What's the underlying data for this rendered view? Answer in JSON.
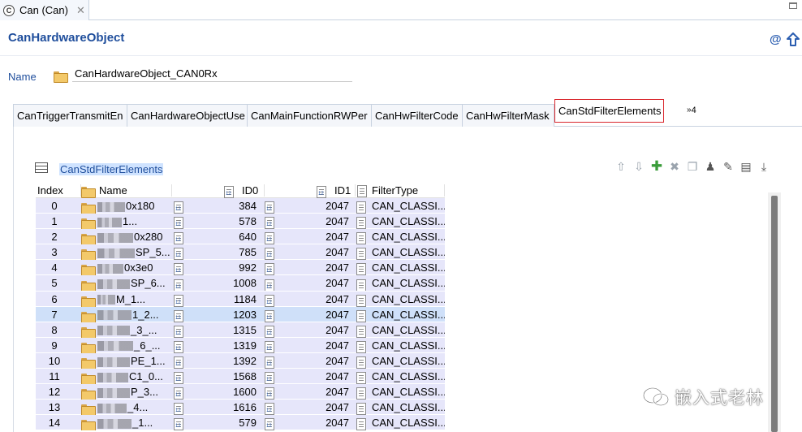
{
  "editor_tab": {
    "title": "Can (Can)",
    "close": "✕"
  },
  "header": {
    "title": "CanHardwareObject"
  },
  "name_field": {
    "label": "Name",
    "value": "CanHardwareObject_CAN0Rx"
  },
  "tabs": [
    {
      "label": "CanTriggerTransmitEn",
      "active": false
    },
    {
      "label": "CanHardwareObjectUse",
      "active": false
    },
    {
      "label": "CanMainFunctionRWPer",
      "active": false
    },
    {
      "label": "CanHwFilterCode",
      "active": false
    },
    {
      "label": "CanHwFilterMask",
      "active": false
    },
    {
      "label": "CanStdFilterElements",
      "active": true
    }
  ],
  "tabs_more": {
    "chevron": "»",
    "count": "4"
  },
  "section": {
    "title": "CanStdFilterElements"
  },
  "table": {
    "columns": {
      "index": "Index",
      "name": "Name",
      "id0": "ID0",
      "id1": "ID1",
      "filtertype": "FilterType"
    },
    "rows": [
      {
        "index": "0",
        "name": "0x180",
        "id0": "384",
        "id1": "2047",
        "filtertype": "CAN_CLASSI...",
        "selected": false
      },
      {
        "index": "1",
        "name": "1...",
        "id0": "578",
        "id1": "2047",
        "filtertype": "CAN_CLASSI...",
        "selected": false
      },
      {
        "index": "2",
        "name": "0x280",
        "id0": "640",
        "id1": "2047",
        "filtertype": "CAN_CLASSI...",
        "selected": false
      },
      {
        "index": "3",
        "name": "SP_5...",
        "id0": "785",
        "id1": "2047",
        "filtertype": "CAN_CLASSI...",
        "selected": false
      },
      {
        "index": "4",
        "name": "0x3e0",
        "id0": "992",
        "id1": "2047",
        "filtertype": "CAN_CLASSI...",
        "selected": false
      },
      {
        "index": "5",
        "name": "SP_6...",
        "id0": "1008",
        "id1": "2047",
        "filtertype": "CAN_CLASSI...",
        "selected": false
      },
      {
        "index": "6",
        "name": "M_1...",
        "id0": "1184",
        "id1": "2047",
        "filtertype": "CAN_CLASSI...",
        "selected": false
      },
      {
        "index": "7",
        "name": "1_2...",
        "id0": "1203",
        "id1": "2047",
        "filtertype": "CAN_CLASSI...",
        "selected": true
      },
      {
        "index": "8",
        "name": "_3_...",
        "id0": "1315",
        "id1": "2047",
        "filtertype": "CAN_CLASSI...",
        "selected": false
      },
      {
        "index": "9",
        "name": "_6_...",
        "id0": "1319",
        "id1": "2047",
        "filtertype": "CAN_CLASSI...",
        "selected": false
      },
      {
        "index": "10",
        "name": "PE_1...",
        "id0": "1392",
        "id1": "2047",
        "filtertype": "CAN_CLASSI...",
        "selected": false
      },
      {
        "index": "11",
        "name": "C1_0...",
        "id0": "1568",
        "id1": "2047",
        "filtertype": "CAN_CLASSI...",
        "selected": false
      },
      {
        "index": "12",
        "name": "P_3...",
        "id0": "1600",
        "id1": "2047",
        "filtertype": "CAN_CLASSI...",
        "selected": false
      },
      {
        "index": "13",
        "name": "_4...",
        "id0": "1616",
        "id1": "2047",
        "filtertype": "CAN_CLASSI...",
        "selected": false
      },
      {
        "index": "14",
        "name": "_1...",
        "id0": "579",
        "id1": "2047",
        "filtertype": "CAN_CLASSI...",
        "selected": false
      }
    ]
  },
  "watermark": {
    "text": "嵌入式老林"
  },
  "colors": {
    "title_blue": "#1f4e9c",
    "row_bg": "#e6e6fa",
    "row_selected": "#cfe0f9",
    "active_tab_border": "#d9262c"
  }
}
